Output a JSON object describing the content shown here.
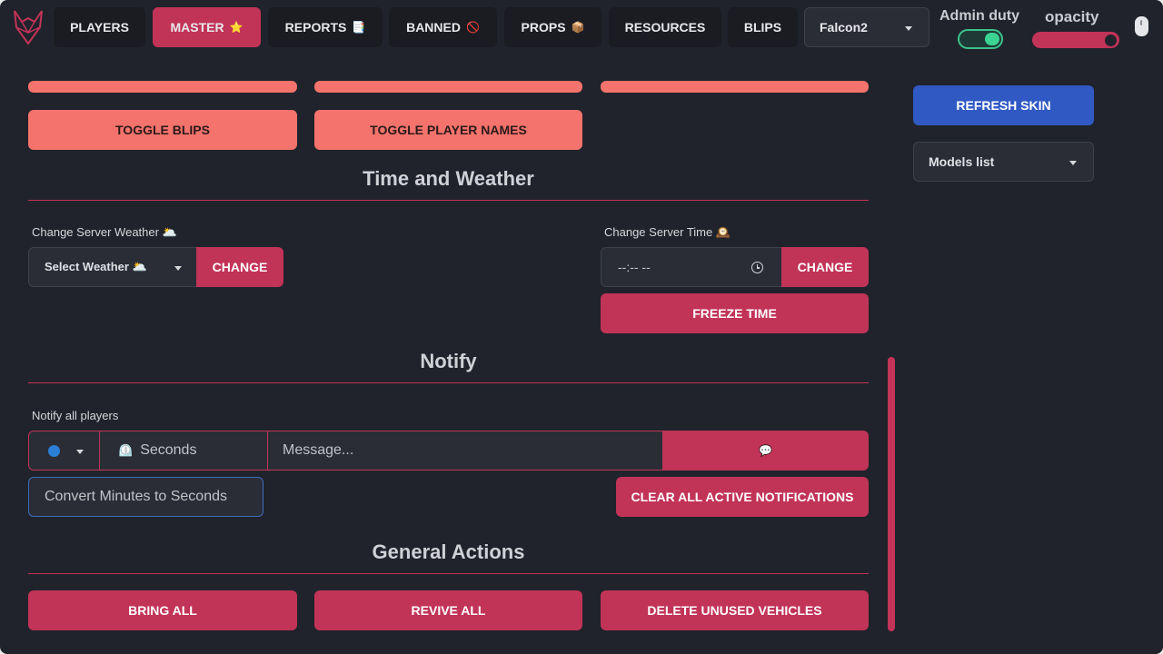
{
  "topbar": {
    "tabs": [
      {
        "label": "PLAYERS",
        "emoji": ""
      },
      {
        "label": "MASTER",
        "emoji": "⭐"
      },
      {
        "label": "REPORTS",
        "emoji": "📑"
      },
      {
        "label": "BANNED",
        "emoji": "🚫"
      },
      {
        "label": "PROPS",
        "emoji": "📦"
      },
      {
        "label": "RESOURCES",
        "emoji": ""
      },
      {
        "label": "BLIPS",
        "emoji": ""
      }
    ],
    "active_tab": "MASTER",
    "player_select": "Falcon2",
    "admin_duty_label": "Admin duty",
    "admin_duty_on": true,
    "opacity_label": "opacity",
    "opacity_value": 0.9
  },
  "master": {
    "toggle_blips": "TOGGLE BLIPS",
    "toggle_player_names": "TOGGLE PLAYER NAMES",
    "time_weather": {
      "title": "Time and Weather",
      "weather_label": "Change Server Weather 🌥️",
      "weather_select": "Select Weather 🌥️",
      "weather_change": "CHANGE",
      "time_label": "Change Server Time 🕰️",
      "time_value": "--:-- --",
      "time_change": "CHANGE",
      "freeze_time": "FREEZE TIME"
    },
    "notify": {
      "title": "Notify",
      "label": "Notify all players",
      "seconds_prefix": "⏲️",
      "seconds_placeholder": "Seconds",
      "message_placeholder": "Message...",
      "send_emoji": "💬",
      "convert_placeholder": "Convert Minutes to Seconds",
      "clear_all": "CLEAR ALL ACTIVE NOTIFICATIONS"
    },
    "general": {
      "title": "General Actions",
      "bring_all": "BRING ALL",
      "revive_all": "REVIVE ALL",
      "delete_unused": "DELETE UNUSED VEHICLES"
    }
  },
  "side": {
    "refresh_skin": "REFRESH SKIN",
    "models_list": "Models list"
  },
  "colors": {
    "background": "#20232b",
    "accent": "#c23358",
    "salmon": "#f4736c",
    "blue": "#3059c4",
    "toggle_on": "#3cd493"
  }
}
